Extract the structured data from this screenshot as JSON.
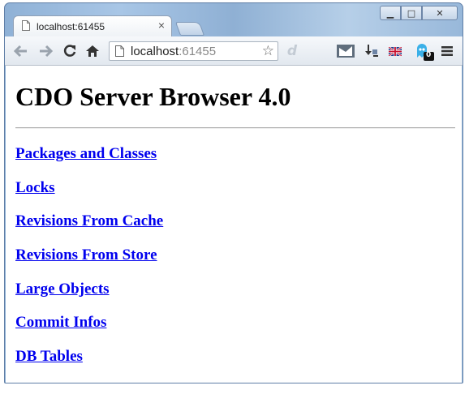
{
  "browser": {
    "tab": {
      "title": "localhost:61455",
      "close_glyph": "×"
    },
    "window_controls": {
      "minimize": "▁",
      "maximize": "□",
      "close": "✕"
    },
    "omnibox": {
      "host": "localhost",
      "port": ":61455"
    },
    "extensions": {
      "badge_count": "0"
    },
    "icons": [
      "page-icon",
      "back-arrow-icon",
      "forward-arrow-icon",
      "reload-icon",
      "home-icon",
      "star-icon",
      "bookmark-extension-icon",
      "download-icon",
      "uk-flag-icon",
      "ghost-extension-icon",
      "menu-icon"
    ]
  },
  "page": {
    "heading": "CDO Server Browser 4.0",
    "links": [
      "Packages and Classes",
      "Locks",
      "Revisions From Cache",
      "Revisions From Store",
      "Large Objects",
      "Commit Infos",
      "DB Tables"
    ]
  },
  "colors": {
    "link": "#0000ee",
    "window_frame": "#5f7ea6"
  }
}
